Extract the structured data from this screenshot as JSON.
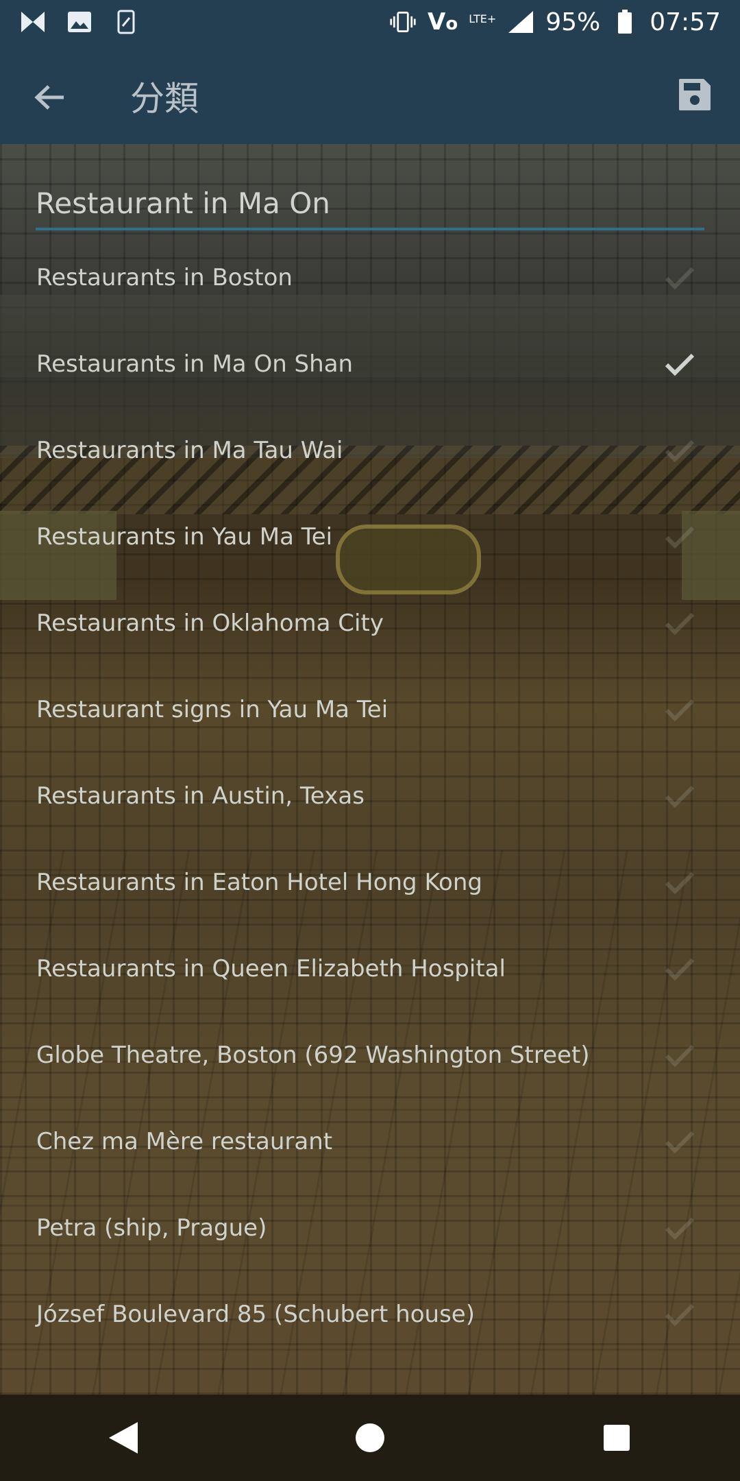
{
  "status_bar": {
    "battery": "95%",
    "time": "07:57",
    "network": "LTE+",
    "left_icons": [
      "app-icon",
      "image-icon",
      "screenshot-icon"
    ],
    "right_icons": [
      "vibrate-icon",
      "volte-icon",
      "signal-icon",
      "battery-icon"
    ]
  },
  "app_bar": {
    "title": "分類",
    "back_icon": "arrow-left-icon",
    "save_icon": "save-icon",
    "color": "#243f51"
  },
  "search": {
    "value": "Restaurant in Ma On",
    "underline_color": "#2f6f8a"
  },
  "categories": [
    {
      "label": "Restaurants in Boston",
      "checked": false
    },
    {
      "label": "Restaurants in Ma On Shan",
      "checked": true
    },
    {
      "label": "Restaurants in Ma Tau Wai",
      "checked": false
    },
    {
      "label": "Restaurants in Yau Ma Tei",
      "checked": false
    },
    {
      "label": "Restaurants in Oklahoma City",
      "checked": false
    },
    {
      "label": "Restaurant signs in Yau Ma Tei",
      "checked": false
    },
    {
      "label": "Restaurants in Austin, Texas",
      "checked": false
    },
    {
      "label": "Restaurants in Eaton Hotel Hong Kong",
      "checked": false
    },
    {
      "label": "Restaurants in Queen Elizabeth Hospital",
      "checked": false
    },
    {
      "label": "Globe Theatre, Boston (692 Washington Street)",
      "checked": false
    },
    {
      "label": "Chez ma Mère restaurant",
      "checked": false
    },
    {
      "label": "Petra (ship, Prague)",
      "checked": false
    },
    {
      "label": "József Boulevard 85 (Schubert house)",
      "checked": false
    }
  ],
  "fab": {
    "icon": "chevron-up-icon",
    "color": "#2b5770"
  },
  "nav_bar": {
    "buttons": [
      "back-triangle-icon",
      "home-circle-icon",
      "recents-square-icon"
    ]
  }
}
